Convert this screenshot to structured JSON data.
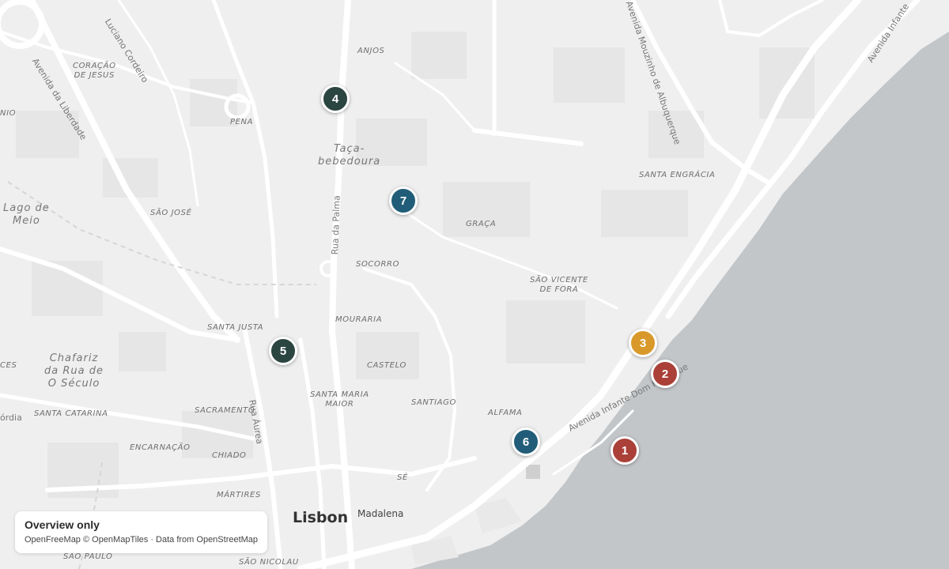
{
  "map": {
    "city_label": "Lisbon",
    "town_label": "Madalena",
    "neighborhoods": [
      {
        "name": "neighborhood-coracao-de-jesus",
        "lines": [
          "CORAÇÃO",
          "DE JESUS"
        ]
      },
      {
        "name": "neighborhood-anjos",
        "lines": [
          "ANJOS"
        ]
      },
      {
        "name": "neighborhood-pena",
        "lines": [
          "PENA"
        ]
      },
      {
        "name": "neighborhood-sao-jose",
        "lines": [
          "SÃO JOSÉ"
        ]
      },
      {
        "name": "neighborhood-socorro",
        "lines": [
          "SOCORRO"
        ]
      },
      {
        "name": "neighborhood-graca",
        "lines": [
          "GRAÇA"
        ]
      },
      {
        "name": "neighborhood-santa-engracia",
        "lines": [
          "SANTA ENGRÁCIA"
        ]
      },
      {
        "name": "neighborhood-sao-vicente-de-fora",
        "lines": [
          "SÃO VICENTE",
          "DE FORA"
        ]
      },
      {
        "name": "neighborhood-santa-justa",
        "lines": [
          "SANTA JUSTA"
        ]
      },
      {
        "name": "neighborhood-mouraria",
        "lines": [
          "MOURARIA"
        ]
      },
      {
        "name": "neighborhood-castelo",
        "lines": [
          "CASTELO"
        ]
      },
      {
        "name": "neighborhood-santa-maria-maior",
        "lines": [
          "SANTA MARIA",
          "MAIOR"
        ]
      },
      {
        "name": "neighborhood-santiago",
        "lines": [
          "SANTIAGO"
        ]
      },
      {
        "name": "neighborhood-alfama",
        "lines": [
          "ALFAMA"
        ]
      },
      {
        "name": "neighborhood-sacramento",
        "lines": [
          "SACRAMENTO"
        ]
      },
      {
        "name": "neighborhood-santa-catarina",
        "lines": [
          "SANTA CATARINA"
        ]
      },
      {
        "name": "neighborhood-encarnacao",
        "lines": [
          "ENCARNAÇÃO"
        ]
      },
      {
        "name": "neighborhood-chiado",
        "lines": [
          "CHIADO"
        ]
      },
      {
        "name": "neighborhood-se",
        "lines": [
          "SÉ"
        ]
      },
      {
        "name": "neighborhood-martires",
        "lines": [
          "MÁRTIRES"
        ]
      },
      {
        "name": "neighborhood-sao-paulo",
        "lines": [
          "SÃO PAULO"
        ]
      },
      {
        "name": "neighborhood-sao-nicolau",
        "lines": [
          "SÃO NICOLAU"
        ]
      },
      {
        "name": "neighborhood-ces-fragment",
        "lines": [
          "CES"
        ]
      },
      {
        "name": "neighborhood-nio-fragment",
        "lines": [
          "NIO"
        ]
      }
    ],
    "places": [
      {
        "name": "place-taca-bebedoura",
        "lines": [
          "Taça-",
          "bebedoura"
        ]
      },
      {
        "name": "place-lago-de-meio",
        "lines": [
          "Lago de",
          "Meio"
        ]
      },
      {
        "name": "place-chafariz-rua-o-seculo",
        "lines": [
          "Chafariz",
          "da Rua de",
          "O Século"
        ]
      }
    ],
    "streets": [
      {
        "name": "street-luciano-cordeiro",
        "text": "Luciano Cordeiro"
      },
      {
        "name": "street-avenida-da-liberdade",
        "text": "Avenida da Liberdade"
      },
      {
        "name": "street-rua-da-palma",
        "text": "Rua da Palma"
      },
      {
        "name": "street-avenida-mouzinho-de-albuquerque",
        "text": "Avenida Mouzinho de Albuquerque"
      },
      {
        "name": "street-avenida-infante-top",
        "text": "Avenida Infante"
      },
      {
        "name": "street-avenida-infante-dom-henrique",
        "text": "Avenida Infante Dom Henrique"
      },
      {
        "name": "street-rua-aurea",
        "text": "Rua Áurea"
      },
      {
        "name": "street-fragment-ordia",
        "text": "órdia"
      }
    ]
  },
  "markers": [
    {
      "label": "1",
      "color": "#ab4038"
    },
    {
      "label": "2",
      "color": "#ab4038"
    },
    {
      "label": "3",
      "color": "#d9992a"
    },
    {
      "label": "4",
      "color": "#2b4541"
    },
    {
      "label": "5",
      "color": "#2b4541"
    },
    {
      "label": "6",
      "color": "#215d78"
    },
    {
      "label": "7",
      "color": "#215d78"
    }
  ],
  "overlay": {
    "title": "Overview only",
    "attribution": "OpenFreeMap © OpenMapTiles · Data from OpenStreetMap"
  }
}
